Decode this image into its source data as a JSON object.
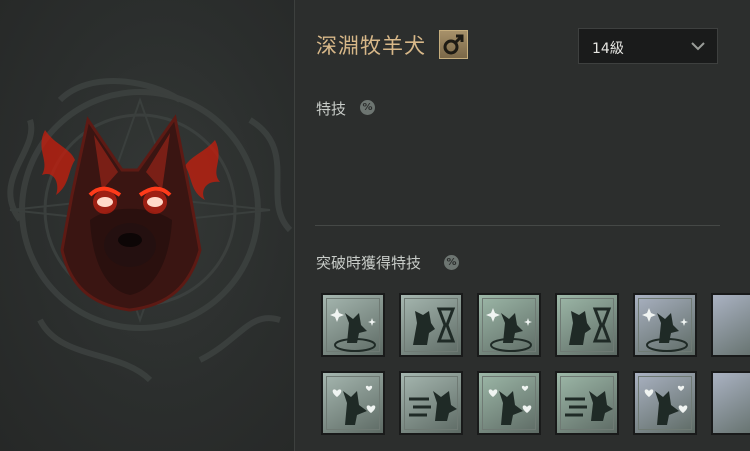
{
  "pet": {
    "name": "深淵牧羊犬",
    "gender_icon": "male-symbol-icon"
  },
  "level_select": {
    "value": "14級"
  },
  "sections": {
    "skills_label": "特技",
    "breakthrough_label": "突破時獲得特技",
    "info_badge": "%"
  },
  "perks": {
    "row1": [
      {
        "icon": "dog-sparkle-icon",
        "tint": "#a6b7b0"
      },
      {
        "icon": "dog-hourglass-icon",
        "tint": "#a6b7b0"
      },
      {
        "icon": "dog-sparkle-icon",
        "tint": "#9db8a8"
      },
      {
        "icon": "dog-hourglass-icon",
        "tint": "#9db8a8"
      },
      {
        "icon": "dog-sparkle-icon",
        "tint": "#aab2c2"
      }
    ],
    "row2": [
      {
        "icon": "dog-hearts-icon",
        "tint": "#a6b7b0"
      },
      {
        "icon": "dog-dash-icon",
        "tint": "#a6b7b0"
      },
      {
        "icon": "dog-hearts-icon",
        "tint": "#9db8a8"
      },
      {
        "icon": "dog-dash-icon",
        "tint": "#9db8a8"
      },
      {
        "icon": "dog-hearts-icon",
        "tint": "#aab2c2"
      }
    ]
  },
  "colors": {
    "name": "#d8b889",
    "eye_glow": "#ff2a14",
    "flame": "#c81e0c"
  }
}
